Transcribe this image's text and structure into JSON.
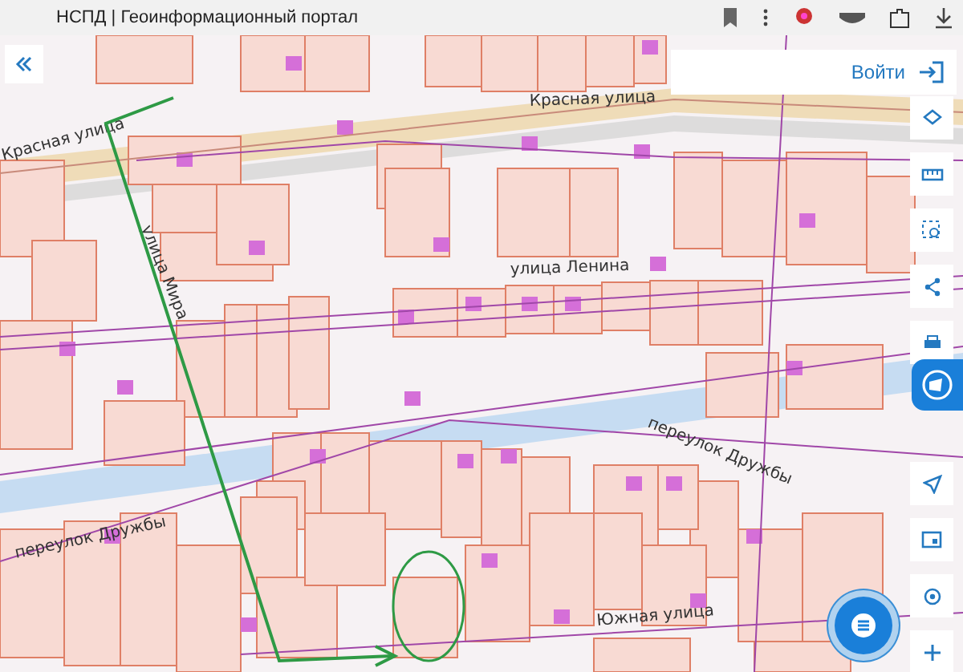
{
  "browser_tab": {
    "title": "НСПД | Геоинформационный портал"
  },
  "login_button": {
    "label": "Войти"
  },
  "map": {
    "street_labels": [
      "Красная улица",
      "Красная улица",
      "улица Мира",
      "улица Ленина",
      "переулок Дружбы",
      "переулок Дружбы",
      "Южная улица"
    ]
  }
}
